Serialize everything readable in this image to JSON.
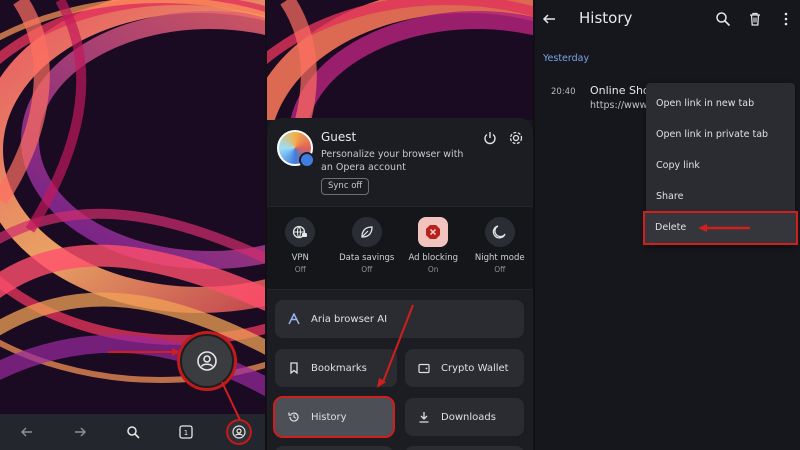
{
  "panel2": {
    "profile": {
      "name": "Guest",
      "description": "Personalize your browser with an Opera account",
      "sync_button": "Sync off"
    },
    "quick_toggles": [
      {
        "label": "VPN",
        "state": "Off",
        "icon": "vpn-globe-icon"
      },
      {
        "label": "Data savings",
        "state": "Off",
        "icon": "leaf-icon"
      },
      {
        "label": "Ad blocking",
        "state": "On",
        "icon": "ad-block-icon"
      },
      {
        "label": "Night mode",
        "state": "Off",
        "icon": "moon-icon"
      }
    ],
    "menu": {
      "aria": "Aria browser AI",
      "bookmarks": "Bookmarks",
      "crypto_wallet": "Crypto Wallet",
      "history": "History",
      "downloads": "Downloads"
    }
  },
  "panel3": {
    "title": "History",
    "section": "Yesterday",
    "entry": {
      "time": "20:40",
      "title": "Online Sho",
      "url": "https://www"
    },
    "context_menu": [
      "Open link in new tab",
      "Open link in private tab",
      "Copy link",
      "Share",
      "Delete"
    ]
  },
  "colors": {
    "highlight": "#d0201e",
    "accent_blue": "#7ea3e6",
    "ad_block_bg": "#f2c3bf"
  }
}
